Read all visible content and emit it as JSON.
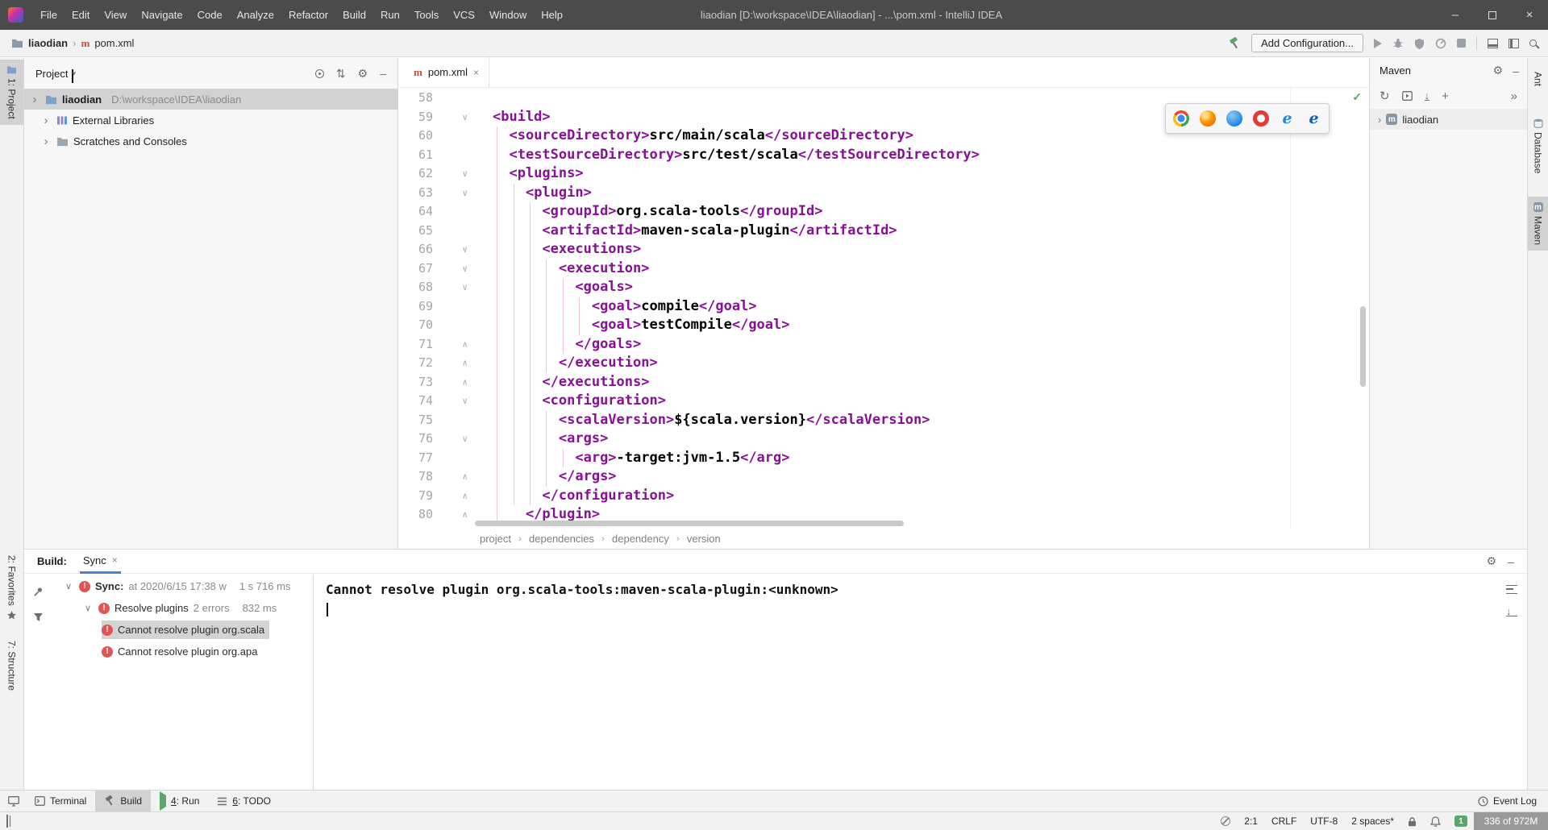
{
  "title_bar": {
    "menus": [
      "File",
      "Edit",
      "View",
      "Navigate",
      "Code",
      "Analyze",
      "Refactor",
      "Build",
      "Run",
      "Tools",
      "VCS",
      "Window",
      "Help"
    ],
    "title": "liaodian [D:\\workspace\\IDEA\\liaodian] - ...\\pom.xml - IntelliJ IDEA"
  },
  "nav_bar": {
    "project": "liaodian",
    "file": "pom.xml",
    "add_configuration": "Add Configuration..."
  },
  "left_strip": {
    "project_tab": "1: Project",
    "favorites_tab": "2: Favorites",
    "structure_tab": "7: Structure"
  },
  "right_strip": {
    "ant_tab": "Ant",
    "database_tab": "Database",
    "maven_tab": "Maven"
  },
  "project_panel": {
    "title": "Project",
    "items": [
      {
        "label": "liaodian",
        "path": "D:\\workspace\\IDEA\\liaodian",
        "icon": "folder",
        "selected": true,
        "level": 0
      },
      {
        "label": "External Libraries",
        "path": "",
        "icon": "libraries",
        "selected": false,
        "level": 1
      },
      {
        "label": "Scratches and Consoles",
        "path": "",
        "icon": "scratches",
        "selected": false,
        "level": 1
      }
    ]
  },
  "editor": {
    "tab": "pom.xml",
    "breadcrumbs": [
      "project",
      "dependencies",
      "dependency",
      "version"
    ],
    "browser_icons": [
      "chrome",
      "firefox",
      "globe",
      "opera",
      "ie",
      "edge"
    ],
    "lines": [
      {
        "n": 58,
        "t": "",
        "f": null
      },
      {
        "n": 59,
        "t": "<build>",
        "f": "down"
      },
      {
        "n": 60,
        "t": "  <sourceDirectory>src/main/scala</sourceDirectory>",
        "f": null
      },
      {
        "n": 61,
        "t": "  <testSourceDirectory>src/test/scala</testSourceDirectory>",
        "f": null
      },
      {
        "n": 62,
        "t": "  <plugins>",
        "f": "down"
      },
      {
        "n": 63,
        "t": "    <plugin>",
        "f": "down"
      },
      {
        "n": 64,
        "t": "      <groupId>org.scala-tools</groupId>",
        "f": null
      },
      {
        "n": 65,
        "t": "      <artifactId>maven-scala-plugin</artifactId>",
        "f": null
      },
      {
        "n": 66,
        "t": "      <executions>",
        "f": "down"
      },
      {
        "n": 67,
        "t": "        <execution>",
        "f": "down"
      },
      {
        "n": 68,
        "t": "          <goals>",
        "f": "down"
      },
      {
        "n": 69,
        "t": "            <goal>compile</goal>",
        "f": null
      },
      {
        "n": 70,
        "t": "            <goal>testCompile</goal>",
        "f": null
      },
      {
        "n": 71,
        "t": "          </goals>",
        "f": "up"
      },
      {
        "n": 72,
        "t": "        </execution>",
        "f": "up"
      },
      {
        "n": 73,
        "t": "      </executions>",
        "f": "up"
      },
      {
        "n": 74,
        "t": "      <configuration>",
        "f": "down"
      },
      {
        "n": 75,
        "t": "        <scalaVersion>${scala.version}</scalaVersion>",
        "f": null
      },
      {
        "n": 76,
        "t": "        <args>",
        "f": "down"
      },
      {
        "n": 77,
        "t": "          <arg>-target:jvm-1.5</arg>",
        "f": null
      },
      {
        "n": 78,
        "t": "        </args>",
        "f": "up"
      },
      {
        "n": 79,
        "t": "      </configuration>",
        "f": "up"
      },
      {
        "n": 80,
        "t": "    </plugin>",
        "f": "up"
      }
    ]
  },
  "maven_panel": {
    "title": "Maven",
    "items": [
      {
        "label": "liaodian"
      }
    ]
  },
  "build_panel": {
    "label": "Build:",
    "tab": "Sync",
    "tree": [
      {
        "icon": "error",
        "chevron": true,
        "title": "Sync:",
        "detail": "at 2020/6/15 17:38 w",
        "time": "1 s 716 ms",
        "level": 0,
        "bold": true,
        "selected": false
      },
      {
        "icon": "error",
        "chevron": true,
        "title": "Resolve plugins",
        "detail": "2 errors",
        "time": "832 ms",
        "level": 1,
        "bold": false,
        "selected": false
      },
      {
        "icon": "error",
        "chevron": false,
        "title": "Cannot resolve plugin org.scala",
        "detail": "",
        "time": "",
        "level": 2,
        "bold": false,
        "selected": true
      },
      {
        "icon": "error",
        "chevron": false,
        "title": "Cannot resolve plugin org.apa",
        "detail": "",
        "time": "",
        "level": 2,
        "bold": false,
        "selected": false
      }
    ],
    "output": "Cannot resolve plugin org.scala-tools:maven-scala-plugin:<unknown>"
  },
  "bottom_bar": {
    "items": [
      {
        "label": "Terminal",
        "icon": "terminal",
        "active": false
      },
      {
        "label": "Build",
        "icon": "hammer",
        "active": true
      },
      {
        "label": "4: Run",
        "icon": "play",
        "active": false
      },
      {
        "label": "6: TODO",
        "icon": "todo",
        "active": false
      }
    ],
    "event_log": "Event Log"
  },
  "status_bar": {
    "position": "2:1",
    "line_sep": "CRLF",
    "encoding": "UTF-8",
    "indent": "2 spaces*",
    "badge": "1",
    "memory": "336 of 972M"
  }
}
